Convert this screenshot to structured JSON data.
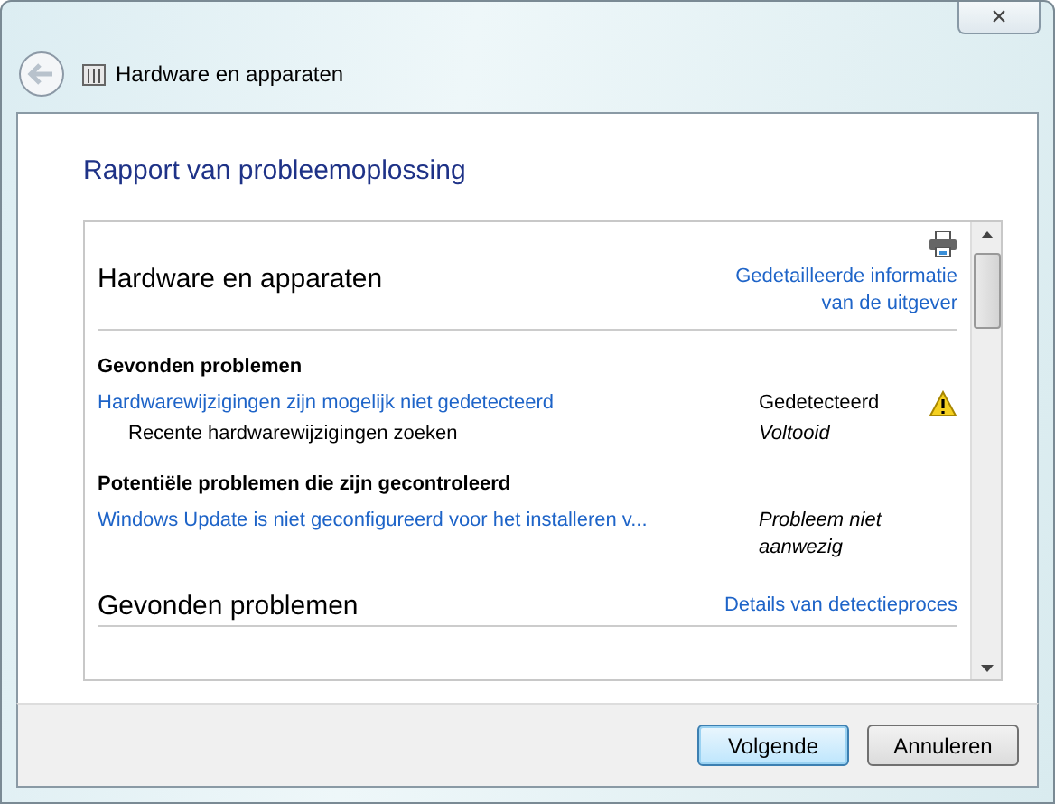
{
  "window": {
    "title": "Hardware en apparaten",
    "close": "×"
  },
  "heading": "Rapport van probleemoplossing",
  "report": {
    "title": "Hardware en apparaten",
    "link": "Gedetailleerde informatie van de uitgever",
    "sections": [
      {
        "heading": "Gevonden problemen",
        "items": [
          {
            "kind": "issue",
            "label": "Hardwarewijzigingen zijn mogelijk niet gedetecteerd",
            "status": "Gedetecteerd",
            "warning": true
          },
          {
            "kind": "step",
            "label": "Recente hardwarewijzigingen zoeken",
            "status": "Voltooid",
            "warning": false
          }
        ]
      },
      {
        "heading": "Potentiële problemen die zijn gecontroleerd",
        "items": [
          {
            "kind": "issue",
            "label": "Windows Update is niet geconfigureerd voor het installeren v...",
            "status": "Probleem niet aanwezig",
            "warning": false
          }
        ]
      }
    ],
    "next_title": "Gevonden problemen",
    "next_link": "Details van detectieproces"
  },
  "buttons": [
    {
      "label": "Volgende",
      "default": true
    },
    {
      "label": "Annuleren",
      "default": false
    }
  ]
}
